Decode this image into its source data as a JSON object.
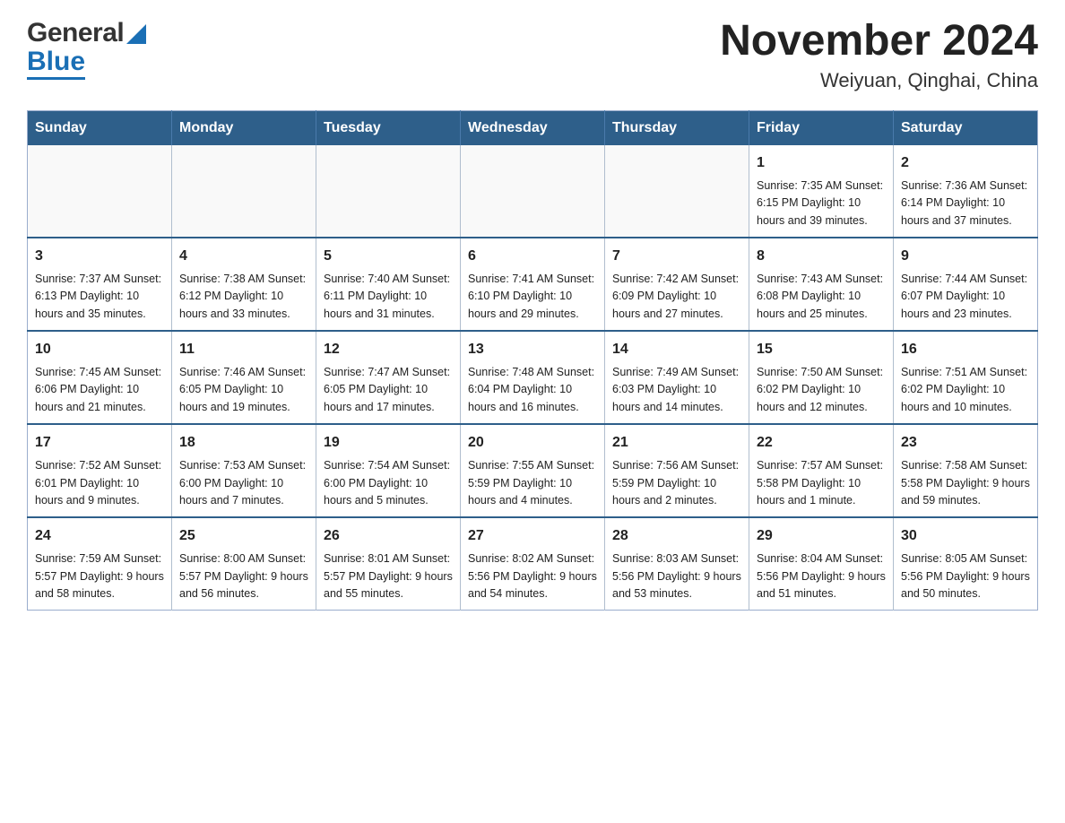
{
  "header": {
    "logo_general": "General",
    "logo_blue": "Blue",
    "title": "November 2024",
    "subtitle": "Weiyuan, Qinghai, China"
  },
  "weekdays": [
    "Sunday",
    "Monday",
    "Tuesday",
    "Wednesday",
    "Thursday",
    "Friday",
    "Saturday"
  ],
  "weeks": [
    {
      "days": [
        {
          "num": "",
          "info": ""
        },
        {
          "num": "",
          "info": ""
        },
        {
          "num": "",
          "info": ""
        },
        {
          "num": "",
          "info": ""
        },
        {
          "num": "",
          "info": ""
        },
        {
          "num": "1",
          "info": "Sunrise: 7:35 AM\nSunset: 6:15 PM\nDaylight: 10 hours\nand 39 minutes."
        },
        {
          "num": "2",
          "info": "Sunrise: 7:36 AM\nSunset: 6:14 PM\nDaylight: 10 hours\nand 37 minutes."
        }
      ]
    },
    {
      "days": [
        {
          "num": "3",
          "info": "Sunrise: 7:37 AM\nSunset: 6:13 PM\nDaylight: 10 hours\nand 35 minutes."
        },
        {
          "num": "4",
          "info": "Sunrise: 7:38 AM\nSunset: 6:12 PM\nDaylight: 10 hours\nand 33 minutes."
        },
        {
          "num": "5",
          "info": "Sunrise: 7:40 AM\nSunset: 6:11 PM\nDaylight: 10 hours\nand 31 minutes."
        },
        {
          "num": "6",
          "info": "Sunrise: 7:41 AM\nSunset: 6:10 PM\nDaylight: 10 hours\nand 29 minutes."
        },
        {
          "num": "7",
          "info": "Sunrise: 7:42 AM\nSunset: 6:09 PM\nDaylight: 10 hours\nand 27 minutes."
        },
        {
          "num": "8",
          "info": "Sunrise: 7:43 AM\nSunset: 6:08 PM\nDaylight: 10 hours\nand 25 minutes."
        },
        {
          "num": "9",
          "info": "Sunrise: 7:44 AM\nSunset: 6:07 PM\nDaylight: 10 hours\nand 23 minutes."
        }
      ]
    },
    {
      "days": [
        {
          "num": "10",
          "info": "Sunrise: 7:45 AM\nSunset: 6:06 PM\nDaylight: 10 hours\nand 21 minutes."
        },
        {
          "num": "11",
          "info": "Sunrise: 7:46 AM\nSunset: 6:05 PM\nDaylight: 10 hours\nand 19 minutes."
        },
        {
          "num": "12",
          "info": "Sunrise: 7:47 AM\nSunset: 6:05 PM\nDaylight: 10 hours\nand 17 minutes."
        },
        {
          "num": "13",
          "info": "Sunrise: 7:48 AM\nSunset: 6:04 PM\nDaylight: 10 hours\nand 16 minutes."
        },
        {
          "num": "14",
          "info": "Sunrise: 7:49 AM\nSunset: 6:03 PM\nDaylight: 10 hours\nand 14 minutes."
        },
        {
          "num": "15",
          "info": "Sunrise: 7:50 AM\nSunset: 6:02 PM\nDaylight: 10 hours\nand 12 minutes."
        },
        {
          "num": "16",
          "info": "Sunrise: 7:51 AM\nSunset: 6:02 PM\nDaylight: 10 hours\nand 10 minutes."
        }
      ]
    },
    {
      "days": [
        {
          "num": "17",
          "info": "Sunrise: 7:52 AM\nSunset: 6:01 PM\nDaylight: 10 hours\nand 9 minutes."
        },
        {
          "num": "18",
          "info": "Sunrise: 7:53 AM\nSunset: 6:00 PM\nDaylight: 10 hours\nand 7 minutes."
        },
        {
          "num": "19",
          "info": "Sunrise: 7:54 AM\nSunset: 6:00 PM\nDaylight: 10 hours\nand 5 minutes."
        },
        {
          "num": "20",
          "info": "Sunrise: 7:55 AM\nSunset: 5:59 PM\nDaylight: 10 hours\nand 4 minutes."
        },
        {
          "num": "21",
          "info": "Sunrise: 7:56 AM\nSunset: 5:59 PM\nDaylight: 10 hours\nand 2 minutes."
        },
        {
          "num": "22",
          "info": "Sunrise: 7:57 AM\nSunset: 5:58 PM\nDaylight: 10 hours\nand 1 minute."
        },
        {
          "num": "23",
          "info": "Sunrise: 7:58 AM\nSunset: 5:58 PM\nDaylight: 9 hours\nand 59 minutes."
        }
      ]
    },
    {
      "days": [
        {
          "num": "24",
          "info": "Sunrise: 7:59 AM\nSunset: 5:57 PM\nDaylight: 9 hours\nand 58 minutes."
        },
        {
          "num": "25",
          "info": "Sunrise: 8:00 AM\nSunset: 5:57 PM\nDaylight: 9 hours\nand 56 minutes."
        },
        {
          "num": "26",
          "info": "Sunrise: 8:01 AM\nSunset: 5:57 PM\nDaylight: 9 hours\nand 55 minutes."
        },
        {
          "num": "27",
          "info": "Sunrise: 8:02 AM\nSunset: 5:56 PM\nDaylight: 9 hours\nand 54 minutes."
        },
        {
          "num": "28",
          "info": "Sunrise: 8:03 AM\nSunset: 5:56 PM\nDaylight: 9 hours\nand 53 minutes."
        },
        {
          "num": "29",
          "info": "Sunrise: 8:04 AM\nSunset: 5:56 PM\nDaylight: 9 hours\nand 51 minutes."
        },
        {
          "num": "30",
          "info": "Sunrise: 8:05 AM\nSunset: 5:56 PM\nDaylight: 9 hours\nand 50 minutes."
        }
      ]
    }
  ]
}
